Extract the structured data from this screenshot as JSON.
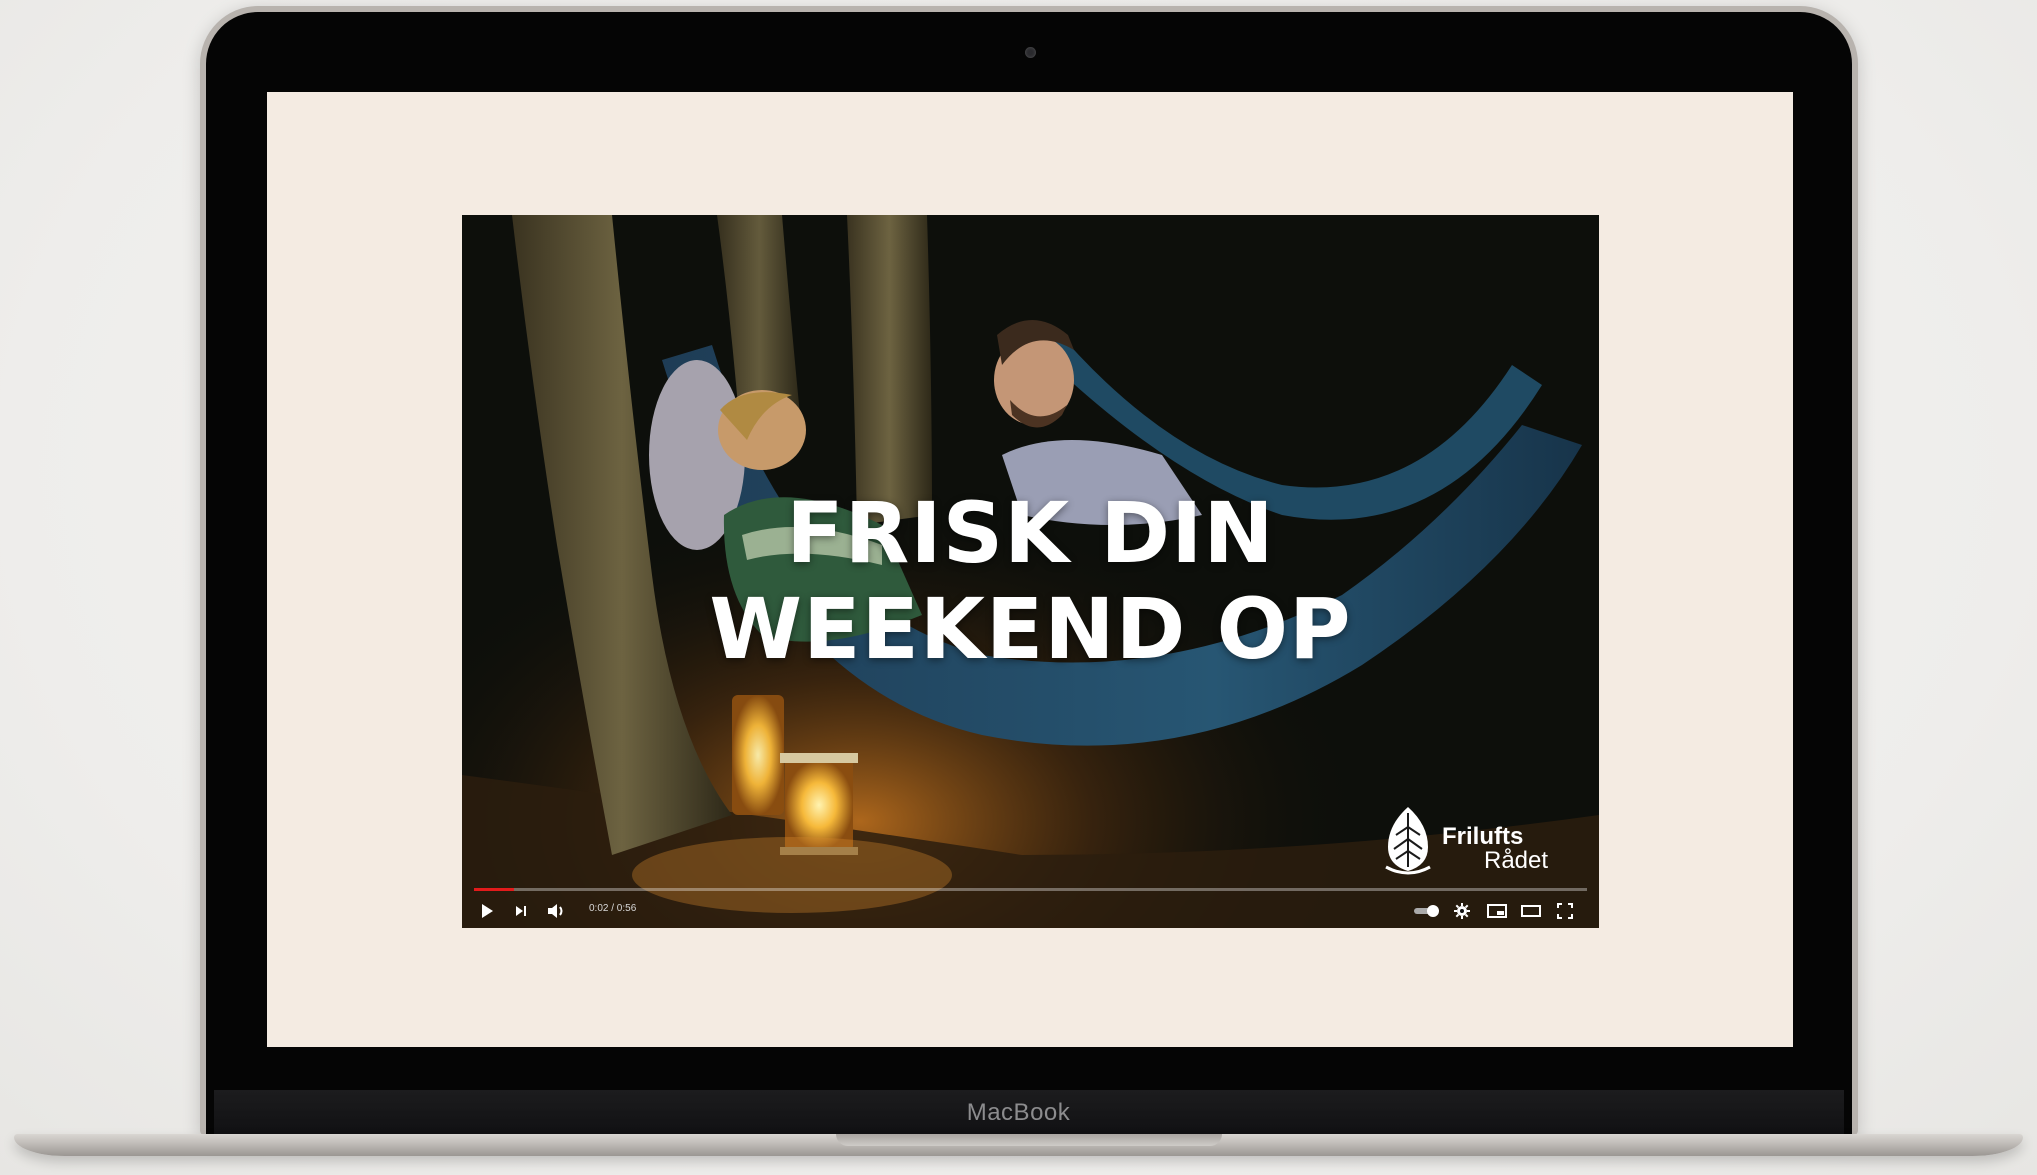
{
  "laptop": {
    "brand_label": "MacBook"
  },
  "video": {
    "title_line1": "FRISK DIN",
    "title_line2": "WEEKEND OP",
    "logo_word1": "Frilufts",
    "logo_word2": "Rådet",
    "player": {
      "current_time": "0:02",
      "duration": "0:56",
      "time_display": "0:02 / 0:56",
      "progress_fraction": 0.036,
      "accent_color": "#e21b1b",
      "controls": [
        "play-icon",
        "next-icon",
        "volume-icon",
        "autoplay-toggle-icon",
        "settings-gear-icon",
        "miniplayer-icon",
        "theater-mode-icon",
        "fullscreen-icon"
      ]
    }
  },
  "colors": {
    "screen_background": "#f4ebe2",
    "bezel": "#050505",
    "title_text": "#ffffff"
  }
}
